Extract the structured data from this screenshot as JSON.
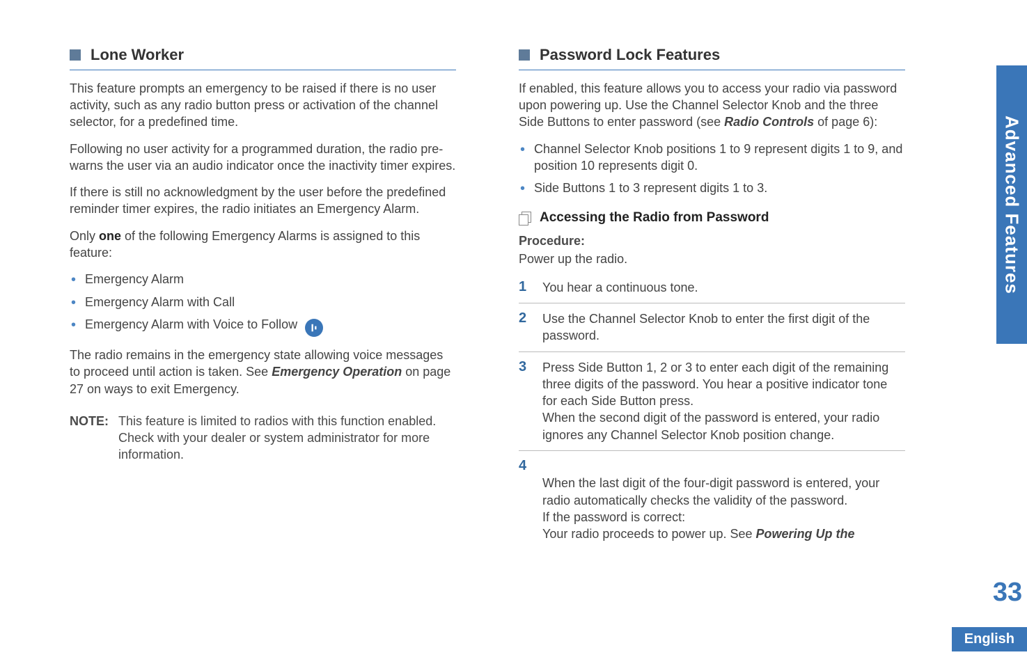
{
  "sidebar": {
    "label": "Advanced Features"
  },
  "page_number": "33",
  "language": "English",
  "left": {
    "heading": "Lone Worker",
    "p1": "This feature prompts an emergency to be raised if there is no user activity, such as any radio button press or activation of the channel selector, for a predefined time.",
    "p2": "Following no user activity for a programmed duration, the radio pre-warns the user via an audio indicator once the inactivity timer expires.",
    "p3": "If there is still no acknowledgment by the user before the predefined reminder timer expires, the radio initiates an Emergency Alarm.",
    "p4a": "Only ",
    "p4b": "one",
    "p4c": " of the following Emergency Alarms is assigned to this feature:",
    "bullets": [
      "Emergency Alarm",
      "Emergency Alarm with Call",
      "Emergency Alarm with Voice to Follow"
    ],
    "p5a": "The radio remains in the emergency state allowing voice messages to proceed until action is taken. See ",
    "p5ref": "Emergency Operation",
    "p5b": " on page 27 on ways to exit Emergency.",
    "note_label": "NOTE:",
    "note_text": "This feature is limited to radios with this function enabled. Check with your dealer or system administrator for more information."
  },
  "right": {
    "heading": "Password Lock Features",
    "p1a": "If enabled, this feature allows you to access your radio via password upon powering up. Use the Channel Selector Knob and the three Side Buttons to enter password (see ",
    "p1ref": "Radio Controls",
    "p1b": " of page 6):",
    "bullets": [
      "Channel Selector Knob positions 1 to 9 represent digits 1 to 9, and position 10 represents digit 0.",
      "Side Buttons 1 to 3 represent digits 1 to 3."
    ],
    "subheading": "Accessing the Radio from Password",
    "procedure_label": "Procedure:",
    "procedure_intro": "Power up the radio.",
    "steps": [
      "You hear a continuous tone.",
      "Use the Channel Selector Knob to enter the first digit of the password.",
      "Press Side Button 1, 2 or 3 to enter each digit of the remaining three digits of the password. You hear a positive indicator tone for each Side Button press.\nWhen the second digit of the password is entered, your radio ignores any Channel Selector Knob position change."
    ],
    "step4a": "When the last digit of the four-digit password is entered, your radio automatically checks the validity of the password.\nIf the password is correct:\nYour radio proceeds to power up. See ",
    "step4ref": "Powering Up the"
  }
}
